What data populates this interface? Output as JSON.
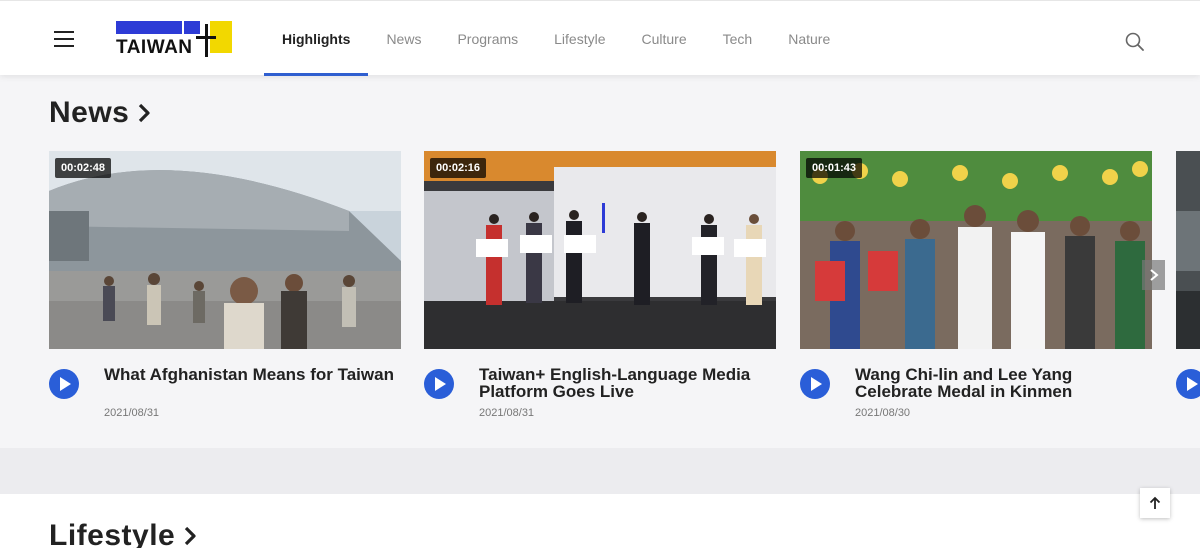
{
  "header": {
    "logo_text": "TAIWAN",
    "logo_mark": "TW",
    "nav": [
      {
        "label": "Highlights",
        "active": true
      },
      {
        "label": "News"
      },
      {
        "label": "Programs"
      },
      {
        "label": "Lifestyle"
      },
      {
        "label": "Culture"
      },
      {
        "label": "Tech"
      },
      {
        "label": "Nature"
      }
    ]
  },
  "news": {
    "title": "News",
    "cards": [
      {
        "duration": "00:02:48",
        "title": "What Afghanistan Means for Taiwan",
        "date": "2021/08/31"
      },
      {
        "duration": "00:02:16",
        "title": "Taiwan+ English-Language Media Platform Goes Live",
        "date": "2021/08/31"
      },
      {
        "duration": "00:01:43",
        "title": "Wang Chi-lin and Lee Yang Celebrate Medal in Kinmen",
        "date": "2021/08/30"
      }
    ]
  },
  "lifestyle": {
    "title": "Lifestyle"
  },
  "icons": {
    "menu": "hamburger-icon",
    "search": "search-icon",
    "play": "play-icon",
    "next": "chevron-right-icon",
    "back_to_top": "arrow-up-icon"
  },
  "colors": {
    "accent": "#2f5fd0",
    "play": "#2a5ed8",
    "logo_blue": "#2d3bd6",
    "logo_yellow": "#f2d800"
  }
}
